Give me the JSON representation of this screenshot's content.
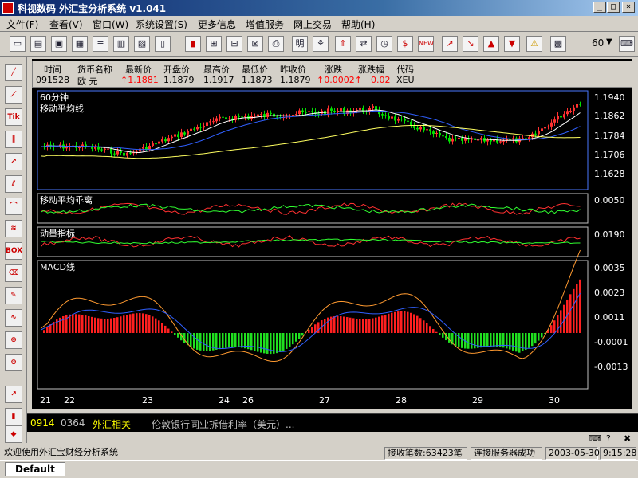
{
  "window": {
    "title": "科视数码 外汇宝分析系统 v1.041",
    "minimize": "_",
    "maximize": "□",
    "close": "×"
  },
  "menu": [
    "文件(F)",
    "查看(V)",
    "窗口(W)",
    "系统设置(S)",
    "更多信息",
    "增值服务",
    "网上交易",
    "帮助(H)"
  ],
  "toolbar": {
    "zoom": "60"
  },
  "left_tools": [
    "Tik",
    "BOX"
  ],
  "quote": {
    "headers": [
      "时间",
      "货币名称",
      "最新价",
      "开盘价",
      "最高价",
      "最低价",
      "昨收价",
      "涨跌",
      "涨跌幅",
      "代码"
    ],
    "values": [
      "091528",
      "欧 元",
      "↑1.1881",
      "1.1879",
      "1.1917",
      "1.1873",
      "1.1879",
      "↑0.0002↑",
      "0.02",
      "XEU"
    ]
  },
  "chart_panels": {
    "main": {
      "title": "60分钟",
      "subtitle": "移动平均线",
      "y_ticks": [
        "1.1940",
        "1.1862",
        "1.1784",
        "1.1706",
        "1.1628"
      ]
    },
    "bias": {
      "title": "移动平均乖离",
      "y_ticks": [
        "0.0050"
      ]
    },
    "momentum": {
      "title": "动量指标",
      "y_ticks": [
        "0.0190"
      ]
    },
    "macd": {
      "title": "MACD线",
      "y_ticks": [
        "0.0035",
        "0.0023",
        "0.0011",
        "-0.0001",
        "-0.0013"
      ]
    },
    "x_ticks": [
      "21",
      "22",
      "23",
      "24",
      "26",
      "27",
      "28",
      "29",
      "30"
    ]
  },
  "news_tab": {
    "code": "0914",
    "count": "0364",
    "category": "外汇相关",
    "headline": "伦敦银行同业拆借利率（美元）..."
  },
  "status": {
    "welcome": "欢迎使用外汇宝财经分析系统",
    "received": "接收笔数:63423笔",
    "connection": "连接服务器成功",
    "date": "2003-05-30",
    "time": "9:15:28"
  },
  "taskbar": {
    "default": "Default"
  },
  "colors": {
    "candle_up": "#ff3030",
    "candle_down": "#00e000",
    "ma_blue": "#3060ff",
    "ma_yellow": "#ffff60",
    "ma_white": "#ffffff",
    "panel_border": "#c0c0c0",
    "chart_bg": "#000000"
  }
}
